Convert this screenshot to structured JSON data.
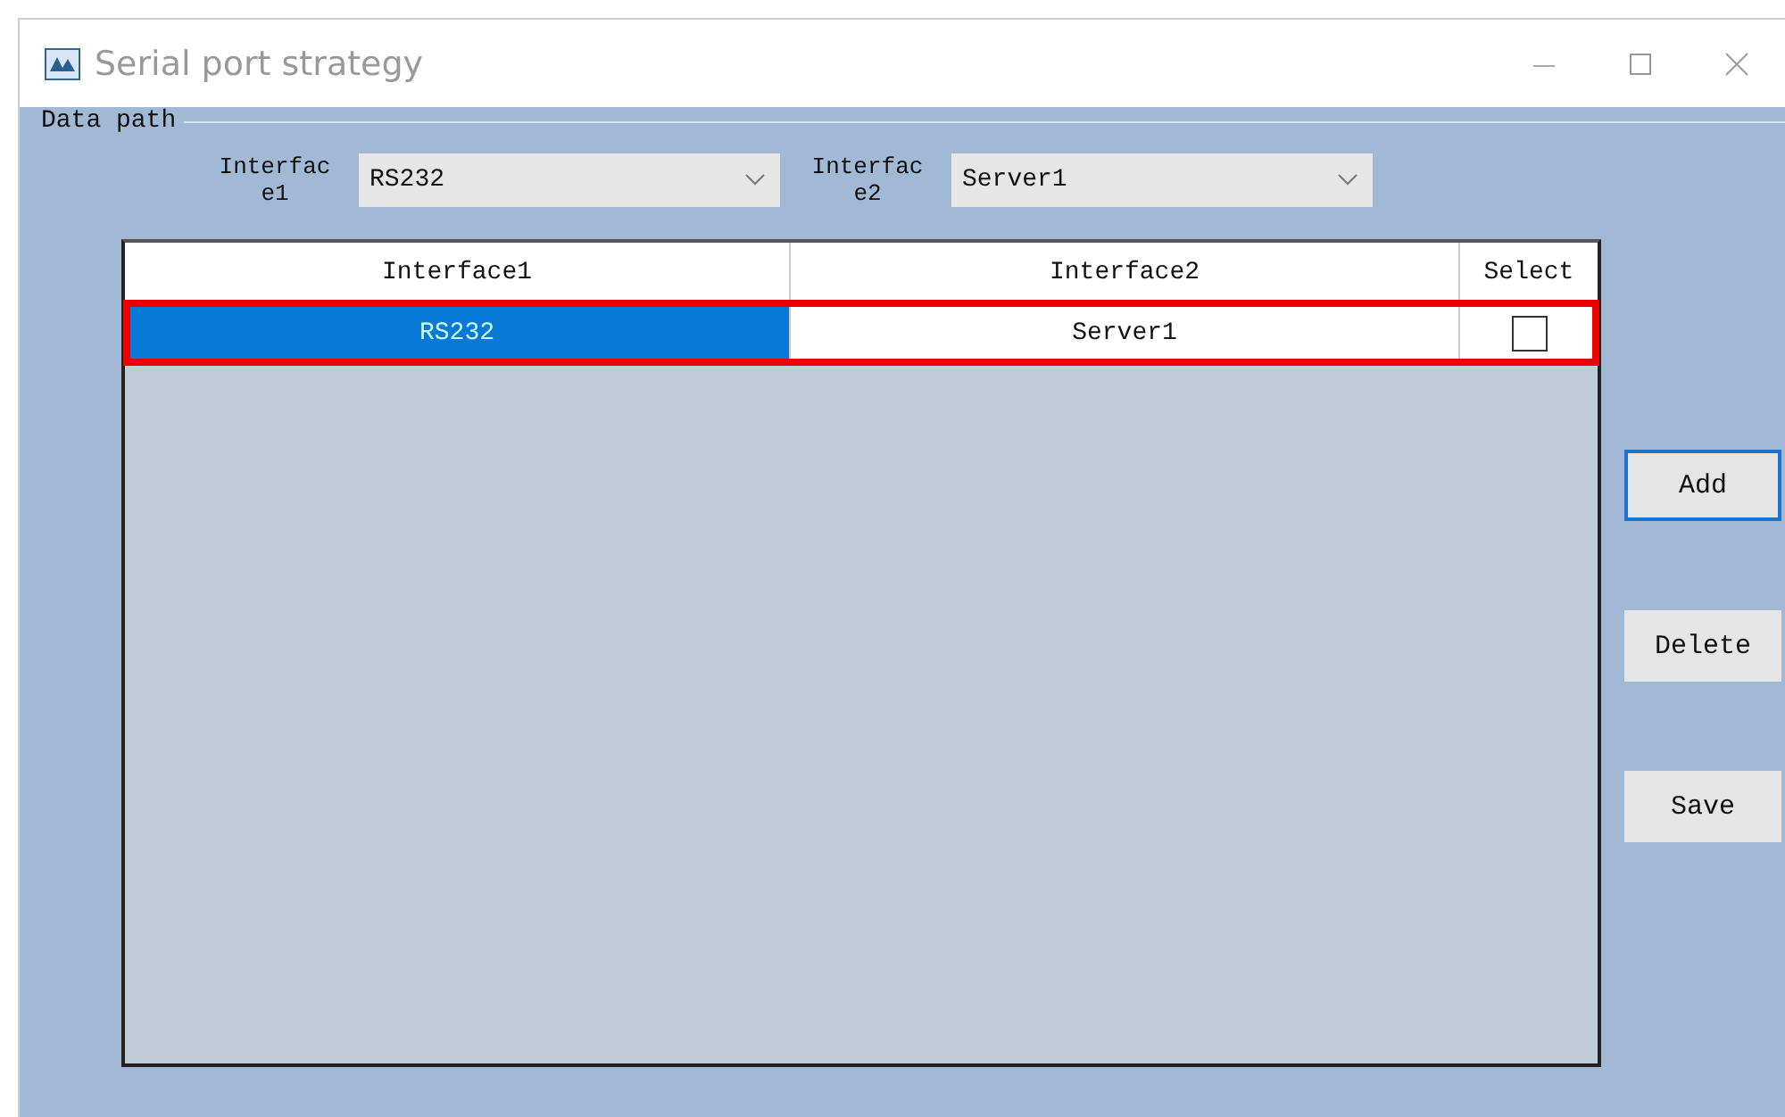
{
  "window": {
    "title": "Serial port strategy"
  },
  "group": {
    "title": "Data path"
  },
  "selectors": [
    {
      "label": "Interface1",
      "value": "RS232"
    },
    {
      "label": "Interface2",
      "value": "Server1"
    }
  ],
  "table": {
    "columns": [
      "Interface1",
      "Interface2",
      "Select"
    ],
    "rows": [
      {
        "highlighted": true,
        "cells": [
          {
            "text": "RS232",
            "selected": true
          },
          {
            "text": "Server1",
            "selected": false
          }
        ],
        "checked": false
      }
    ]
  },
  "buttons": [
    {
      "label": "Add",
      "focused": true
    },
    {
      "label": "Delete",
      "focused": false
    },
    {
      "label": "Save",
      "focused": false
    }
  ]
}
